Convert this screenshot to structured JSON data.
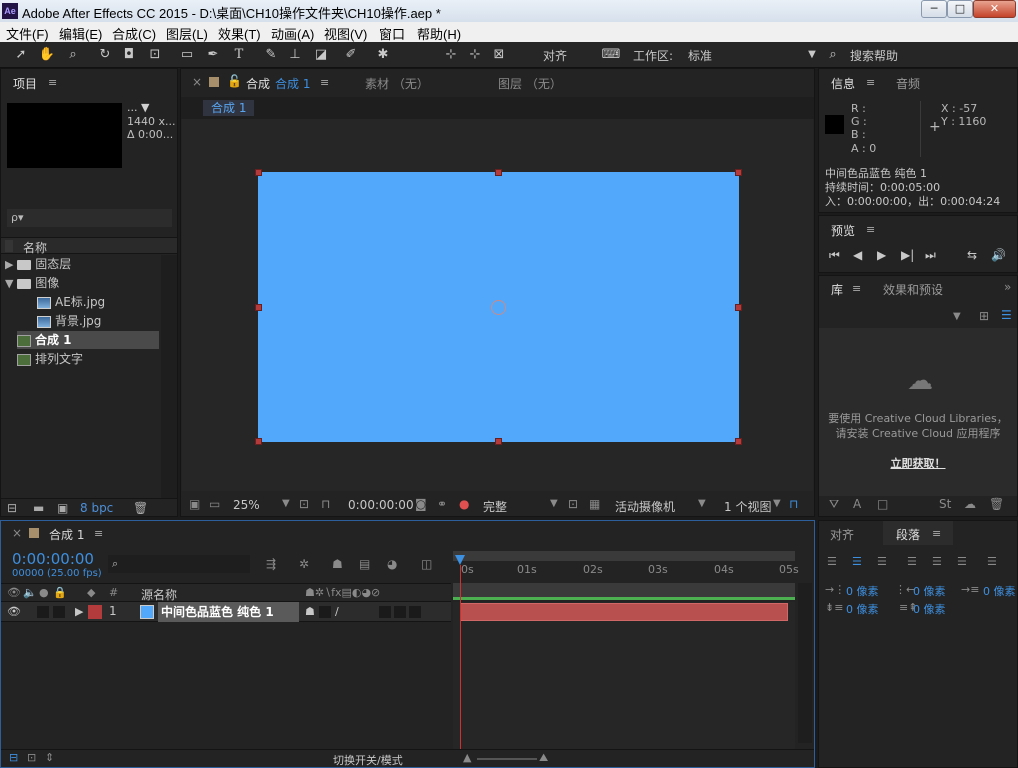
{
  "window": {
    "app_icon": "Ae",
    "title": "Adobe After Effects CC 2015 - D:\\桌面\\CH10操作文件夹\\CH10操作.aep *",
    "min": "─",
    "max": "□",
    "close": "✕"
  },
  "menu": [
    "文件(F)",
    "编辑(E)",
    "合成(C)",
    "图层(L)",
    "效果(T)",
    "动画(A)",
    "视图(V)",
    "窗口",
    "帮助(H)"
  ],
  "toolbar": {
    "snap_label": "对齐",
    "workspace_label": "工作区:",
    "workspace_value": "标准",
    "search_help": "搜索帮助"
  },
  "project": {
    "tab": "项目",
    "info_name": "... ▼",
    "info_size": "1440 x...",
    "info_duration": "Δ 0:00...",
    "search_icon_text": "ρ▾",
    "col_name": "名称",
    "items": [
      {
        "label": "固态层",
        "type": "folder"
      },
      {
        "label": "图像",
        "type": "folder"
      },
      {
        "label": "AE标.jpg",
        "type": "image"
      },
      {
        "label": "背景.jpg",
        "type": "image"
      },
      {
        "label": "合成 1",
        "type": "comp"
      },
      {
        "label": "排列文字",
        "type": "comp"
      }
    ],
    "bpc": "8 bpc"
  },
  "comp_viewer": {
    "tab_prefix": "合成",
    "tab_name": "合成 1",
    "footage_tab": "素材 （无）",
    "layer_tab": "图层 （无）",
    "breadcrumb": "合成 1",
    "canvas_color": "#52a9fb",
    "zoom": "25%",
    "timecode": "0:00:00:00",
    "resolution": "完整",
    "camera": "活动摄像机",
    "views": "1 个视图"
  },
  "info": {
    "tab": "信息",
    "audio_tab": "音频",
    "r": "R :",
    "g": "G :",
    "b": "B :",
    "a": "A : 0",
    "x": "X : -57",
    "y": "Y : 1160",
    "layer_name": "中间色品蓝色 纯色 1",
    "duration": "持续时间：0:00:05:00",
    "inout": "入：0:00:00:00，出：0:00:04:24"
  },
  "preview": {
    "tab": "预览"
  },
  "library": {
    "tab": "库",
    "effects_tab": "效果和预设",
    "msg1": "要使用 Creative Cloud Libraries，",
    "msg2": "请安装 Creative Cloud 应用程序",
    "link": "立即获取！"
  },
  "paragraph": {
    "align_tab": "对齐",
    "para_tab": "段落",
    "indent_left": "0 像素",
    "indent_right": "0 像素",
    "indent_first": "0 像素",
    "space_before": "0 像素",
    "space_after": "0 像素"
  },
  "timeline": {
    "tab": "合成 1",
    "timecode": "0:00:00:00",
    "fps": "00000 (25.00 fps)",
    "col_num": "#",
    "col_source": "源名称",
    "layer_index": "1",
    "layer_name": "中间色品蓝色 纯色 1",
    "layer_label_color": "#b43b3b",
    "ruler": [
      "0s",
      "01s",
      "02s",
      "03s",
      "04s",
      "05s"
    ],
    "switch_mode": "切换开关/模式"
  },
  "colors": {
    "accent": "#3d8fe0",
    "canvas": "#52a9fb",
    "layer_bar": "#b85050",
    "handle": "#b43b3b"
  }
}
